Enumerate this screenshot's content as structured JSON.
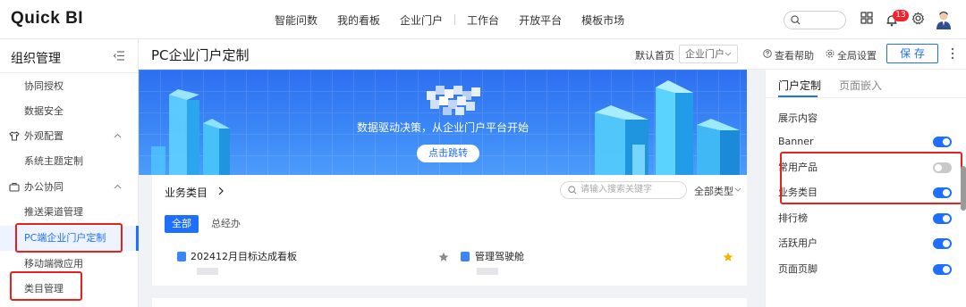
{
  "app": {
    "logo": "Quick BI"
  },
  "topnav": {
    "items": [
      "智能问数",
      "我的看板",
      "企业门户",
      "工作台",
      "开放平台",
      "模板市场"
    ],
    "notification_count": "13"
  },
  "sidebar": {
    "title": "组织管理",
    "items": [
      {
        "label": "协同授权"
      },
      {
        "label": "数据安全"
      },
      {
        "label": "外观配置"
      },
      {
        "label": "系统主题定制"
      },
      {
        "label": "办公协同"
      },
      {
        "label": "推送渠道管理"
      },
      {
        "label": "PC端企业门户定制"
      },
      {
        "label": "移动端微应用"
      },
      {
        "label": "类目管理"
      }
    ]
  },
  "header": {
    "title": "PC企业门户定制",
    "default_home_label": "默认首页",
    "default_home_value": "企业门户",
    "help_label": "查看帮助",
    "global_settings_label": "全局设置",
    "save_label": "保 存"
  },
  "banner": {
    "text": "数据驱动决策，从企业门户平台开始",
    "button": "点击跳转"
  },
  "business": {
    "title": "业务类目",
    "search_placeholder": "请输入搜索关键字",
    "filter_label": "全部类型",
    "tabs": [
      "全部",
      "总经办"
    ],
    "items": [
      {
        "title": "202412月目标达成看板",
        "starred": false
      },
      {
        "title": "管理驾驶舱",
        "starred": true
      }
    ]
  },
  "panel": {
    "tabs": [
      "门户定制",
      "页面嵌入"
    ],
    "section_title": "展示内容",
    "rows": [
      {
        "label": "Banner",
        "on": true
      },
      {
        "label": "常用产品",
        "on": false
      },
      {
        "label": "业务类目",
        "on": true
      },
      {
        "label": "排行榜",
        "on": true
      },
      {
        "label": "活跃用户",
        "on": true
      },
      {
        "label": "页面页脚",
        "on": true
      }
    ]
  },
  "colors": {
    "accent": "#1f6fff",
    "highlight_box": "#e8211c",
    "star": "#f5b400"
  }
}
